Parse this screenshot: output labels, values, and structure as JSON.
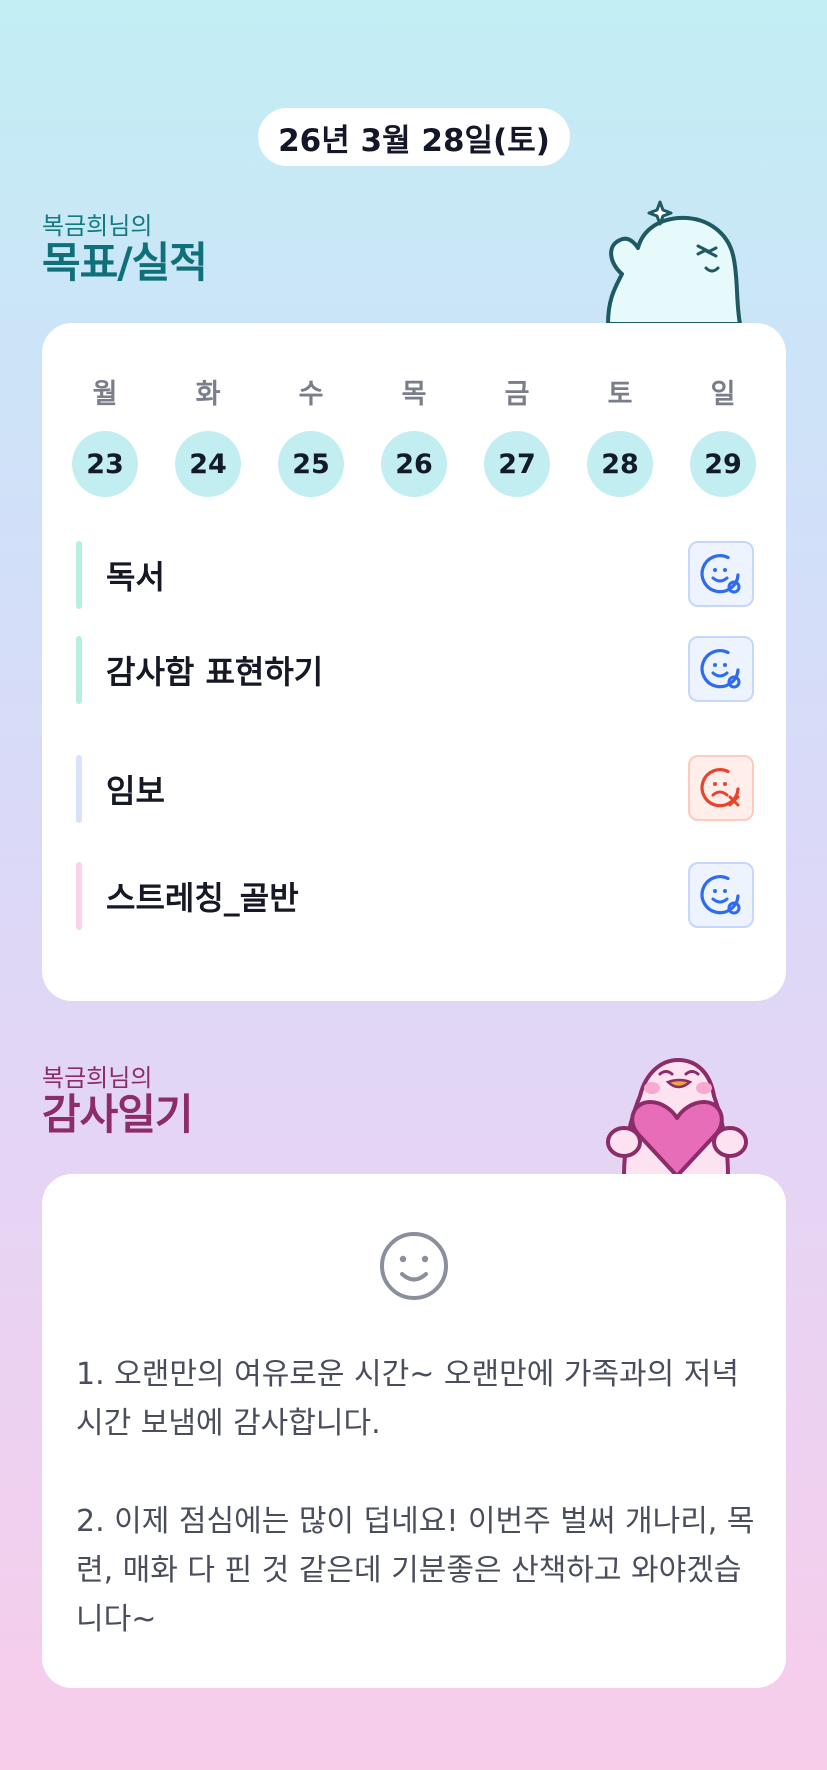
{
  "header": {
    "date": "26년 3월 28일(토)"
  },
  "goals_section": {
    "owner": "복금희님의",
    "title": "목표/실적"
  },
  "week": [
    {
      "name": "월",
      "num": "23"
    },
    {
      "name": "화",
      "num": "24"
    },
    {
      "name": "수",
      "num": "25"
    },
    {
      "name": "목",
      "num": "26"
    },
    {
      "name": "금",
      "num": "27"
    },
    {
      "name": "토",
      "num": "28"
    },
    {
      "name": "일",
      "num": "29"
    }
  ],
  "goals": [
    {
      "label": "독서",
      "status": "success",
      "icon": "smile-check-icon",
      "bar_color": "#b6efdf"
    },
    {
      "label": "감사함 표현하기",
      "status": "success",
      "icon": "smile-check-icon",
      "bar_color": "#b6efdf"
    },
    {
      "label": "임보",
      "status": "failed",
      "icon": "sad-x-icon",
      "bar_color": "#d8e2fb"
    },
    {
      "label": "스트레칭_골반",
      "status": "success",
      "icon": "smile-check-icon",
      "bar_color": "#fbd2ea"
    }
  ],
  "diary_section": {
    "owner": "복금희님의",
    "title": "감사일기",
    "mood_icon": "smile-face-icon"
  },
  "diary": {
    "entry1": "1. 오랜만의 여유로운 시간~ 오랜만에 가족과의 저녁시간 보냄에 감사합니다.",
    "entry2": "2. 이제 점심에는 많이 덥네요!  이번주 벌써 개나리, 목련, 매화 다 핀 것 같은데 기분좋은 산책하고 와야겠습니다~"
  },
  "colors": {
    "goals_accent": "#10707a",
    "diary_accent": "#8c2c68",
    "success": "#2e6bf0",
    "fail": "#e8442c",
    "day_circle": "#c2eef2"
  }
}
